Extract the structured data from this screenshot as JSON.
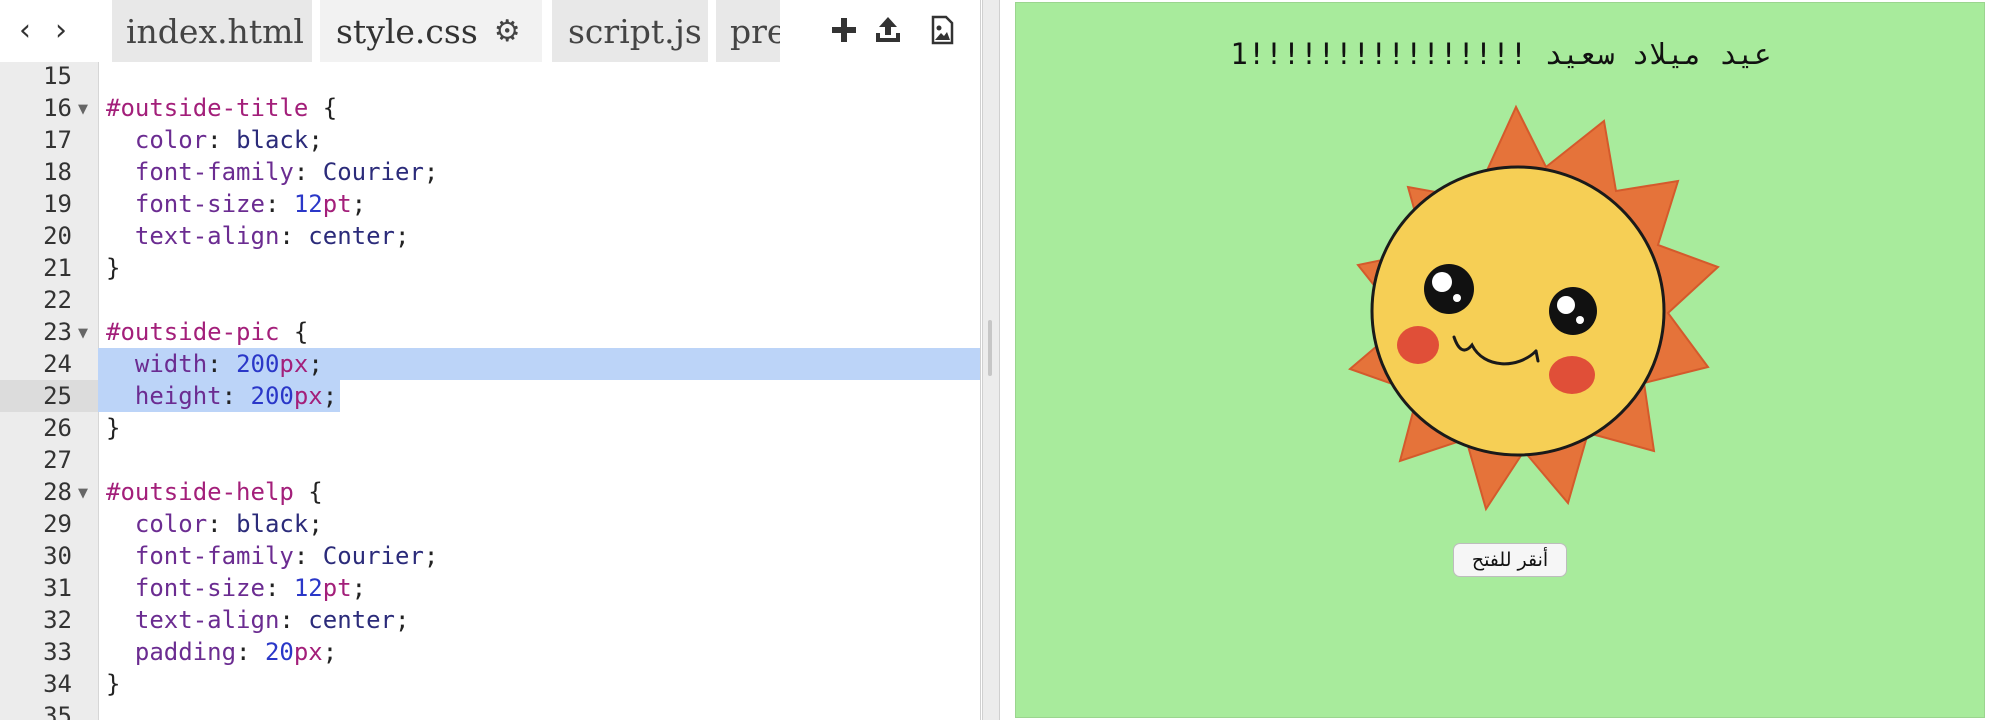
{
  "nav": {
    "back_glyph": "‹",
    "forward_glyph": "›"
  },
  "tabs": [
    {
      "label": "index.html",
      "active": false
    },
    {
      "label": "style.css",
      "active": true
    },
    {
      "label": "script.js",
      "active": false
    },
    {
      "label": "pre",
      "active": false
    }
  ],
  "toolbar": {
    "icons": [
      "plus-icon",
      "upload-icon",
      "image-icon"
    ]
  },
  "editor": {
    "lines": [
      {
        "num": "15",
        "code": []
      },
      {
        "num": "16",
        "fold": true,
        "code": [
          [
            "#outside-title",
            "sel"
          ],
          [
            " {",
            "punc"
          ]
        ]
      },
      {
        "num": "17",
        "code": [
          [
            "  color",
            "prop"
          ],
          [
            ": ",
            "punc"
          ],
          [
            "black",
            "val"
          ],
          [
            ";",
            "punc"
          ]
        ]
      },
      {
        "num": "18",
        "code": [
          [
            "  font-family",
            "prop"
          ],
          [
            ": ",
            "punc"
          ],
          [
            "Courier",
            "val"
          ],
          [
            ";",
            "punc"
          ]
        ]
      },
      {
        "num": "19",
        "code": [
          [
            "  font-size",
            "prop"
          ],
          [
            ": ",
            "punc"
          ],
          [
            "12",
            "num"
          ],
          [
            "pt",
            "unit"
          ],
          [
            ";",
            "punc"
          ]
        ]
      },
      {
        "num": "20",
        "code": [
          [
            "  text-align",
            "prop"
          ],
          [
            ": ",
            "punc"
          ],
          [
            "center",
            "val"
          ],
          [
            ";",
            "punc"
          ]
        ]
      },
      {
        "num": "21",
        "code": [
          [
            "}",
            "punc"
          ]
        ]
      },
      {
        "num": "22",
        "code": []
      },
      {
        "num": "23",
        "fold": true,
        "code": [
          [
            "#outside-pic",
            "sel"
          ],
          [
            " {",
            "punc"
          ]
        ]
      },
      {
        "num": "24",
        "selected": true,
        "code": [
          [
            "  width",
            "prop"
          ],
          [
            ": ",
            "punc"
          ],
          [
            "200",
            "num"
          ],
          [
            "px",
            "unit"
          ],
          [
            ";",
            "punc"
          ]
        ]
      },
      {
        "num": "25",
        "selected": true,
        "active": true,
        "code": [
          [
            "  height",
            "prop"
          ],
          [
            ": ",
            "punc"
          ],
          [
            "200",
            "num"
          ],
          [
            "px",
            "unit"
          ],
          [
            ";",
            "punc"
          ]
        ]
      },
      {
        "num": "26",
        "code": [
          [
            "}",
            "punc"
          ]
        ]
      },
      {
        "num": "27",
        "code": []
      },
      {
        "num": "28",
        "fold": true,
        "code": [
          [
            "#outside-help",
            "sel"
          ],
          [
            " {",
            "punc"
          ]
        ]
      },
      {
        "num": "29",
        "code": [
          [
            "  color",
            "prop"
          ],
          [
            ": ",
            "punc"
          ],
          [
            "black",
            "val"
          ],
          [
            ";",
            "punc"
          ]
        ]
      },
      {
        "num": "30",
        "code": [
          [
            "  font-family",
            "prop"
          ],
          [
            ": ",
            "punc"
          ],
          [
            "Courier",
            "val"
          ],
          [
            ";",
            "punc"
          ]
        ]
      },
      {
        "num": "31",
        "code": [
          [
            "  font-size",
            "prop"
          ],
          [
            ": ",
            "punc"
          ],
          [
            "12",
            "num"
          ],
          [
            "pt",
            "unit"
          ],
          [
            ";",
            "punc"
          ]
        ]
      },
      {
        "num": "32",
        "code": [
          [
            "  text-align",
            "prop"
          ],
          [
            ": ",
            "punc"
          ],
          [
            "center",
            "val"
          ],
          [
            ";",
            "punc"
          ]
        ]
      },
      {
        "num": "33",
        "code": [
          [
            "  padding",
            "prop"
          ],
          [
            ": ",
            "punc"
          ],
          [
            "20",
            "num"
          ],
          [
            "px",
            "unit"
          ],
          [
            ";",
            "punc"
          ]
        ]
      },
      {
        "num": "34",
        "code": [
          [
            "}",
            "punc"
          ]
        ]
      },
      {
        "num": "35",
        "code": []
      }
    ]
  },
  "preview": {
    "title": "عيد ميلاد سعيد !!!!!!!!!!!!!!!!1",
    "open_button": "أنقر للفتح",
    "background": "#a8eb9c",
    "sun_colors": {
      "rays": "#e5733a",
      "face": "#f6cf55",
      "cheeks": "#e04f38"
    }
  }
}
